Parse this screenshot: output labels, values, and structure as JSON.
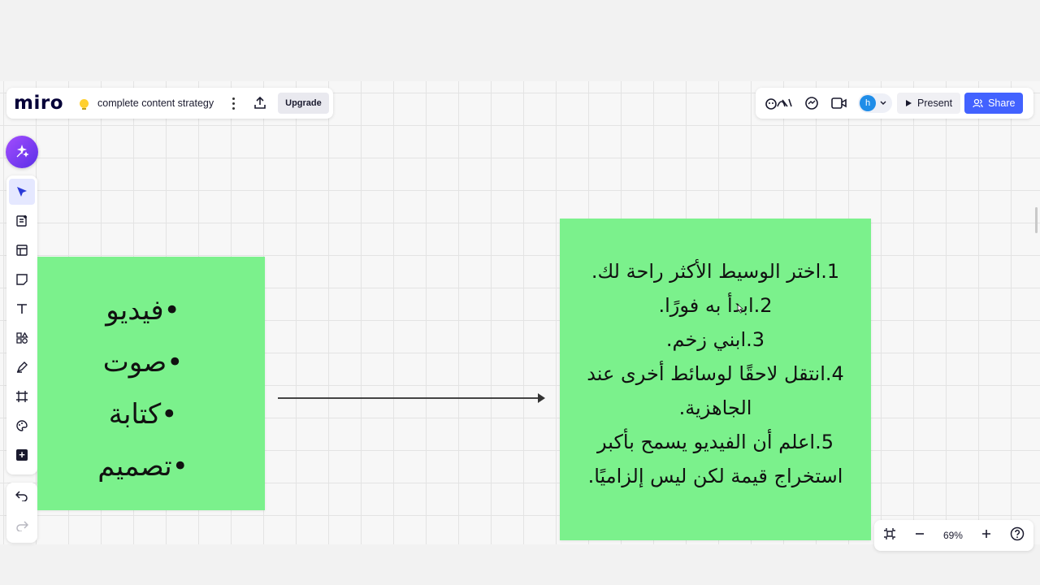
{
  "app": {
    "logo": "miro"
  },
  "board": {
    "name": "complete content strategy",
    "upgrade_label": "Upgrade"
  },
  "collab": {
    "avatar_initial": "h",
    "present_label": "Present",
    "share_label": "Share"
  },
  "toolbar": {
    "tools": [
      "select",
      "templates",
      "frame-layouts",
      "sticky-note",
      "text",
      "shapes",
      "pen",
      "frame",
      "stickers",
      "more"
    ]
  },
  "stickies": {
    "left": {
      "lines": [
        "•فيديو",
        "•صوت",
        "•كتابة",
        "•تصميم"
      ]
    },
    "right": {
      "lines": [
        "1.اختر الوسيط الأكثر راحة لك.",
        "2.ابدأ به فورًا.",
        "3.ابني زخم.",
        "4.انتقل لاحقًا لوسائط أخرى عند",
        "الجاهزية.",
        "5.اعلم أن الفيديو يسمح بأكبر",
        "استخراج قيمة لكن ليس إلزاميًا."
      ]
    }
  },
  "zoom": {
    "level": "69%"
  },
  "colors": {
    "sticky": "#7bf18c",
    "accent": "#4262ff",
    "ai": "#7a3cf0"
  }
}
